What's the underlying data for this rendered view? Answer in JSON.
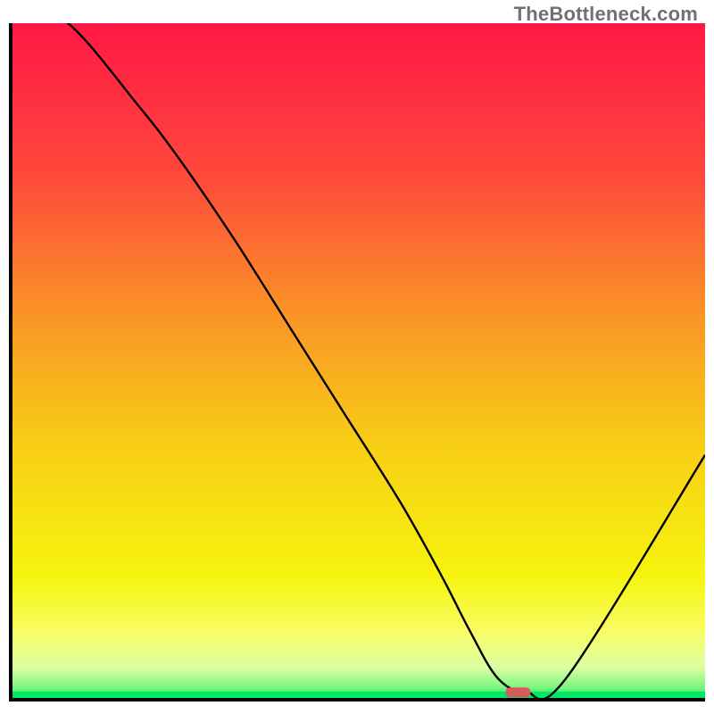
{
  "watermark": "TheBottleneck.com",
  "chart_data": {
    "type": "line",
    "title": "",
    "xlabel": "",
    "ylabel": "",
    "xlim": [
      0,
      100
    ],
    "ylim": [
      0,
      100
    ],
    "x": [
      0,
      8,
      18,
      24,
      32,
      40,
      48,
      56,
      62,
      66,
      70,
      74,
      80,
      100
    ],
    "values": [
      103,
      100,
      88,
      80,
      68,
      55,
      42,
      29,
      18,
      10,
      3,
      1,
      3,
      36
    ],
    "gradient_stops": [
      {
        "pos": 0.0,
        "color": "#ff1846"
      },
      {
        "pos": 0.22,
        "color": "#fe473c"
      },
      {
        "pos": 0.45,
        "color": "#fa9a24"
      },
      {
        "pos": 0.63,
        "color": "#f8cf16"
      },
      {
        "pos": 0.82,
        "color": "#f6f40e"
      },
      {
        "pos": 0.9,
        "color": "#f8fd62"
      },
      {
        "pos": 0.955,
        "color": "#dbfea3"
      },
      {
        "pos": 0.985,
        "color": "#7af57f"
      },
      {
        "pos": 1.0,
        "color": "#00e763"
      }
    ],
    "marker": {
      "x": 73,
      "y": 0.9,
      "color": "#d85a5f"
    },
    "annotations": []
  }
}
